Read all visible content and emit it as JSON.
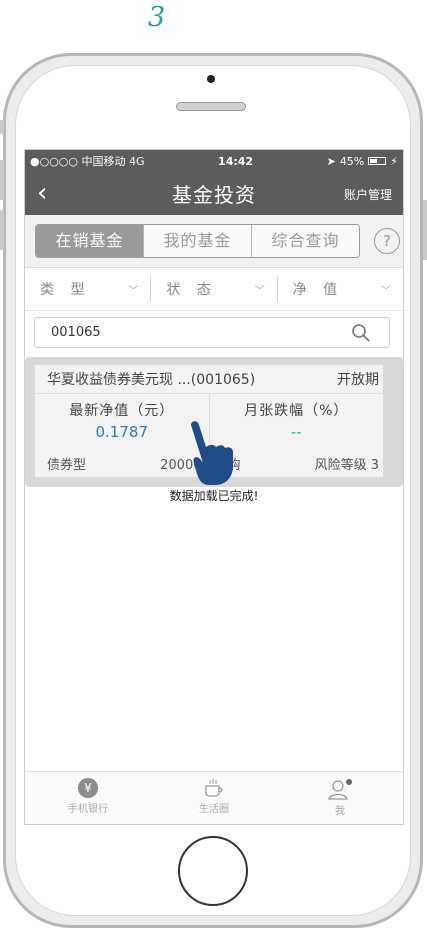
{
  "step_number": "3",
  "status_bar": {
    "carrier": "●○○○○ 中国移动 4G",
    "time": "14:42",
    "battery": "45%"
  },
  "nav": {
    "title": "基金投资",
    "right_label": "账户管理"
  },
  "tabs": [
    {
      "label": "在销基金",
      "active": true
    },
    {
      "label": "我的基金",
      "active": false
    },
    {
      "label": "综合查询",
      "active": false
    }
  ],
  "help_label": "?",
  "filters": [
    {
      "label": "类 型"
    },
    {
      "label": "状 态"
    },
    {
      "label": "净 值"
    }
  ],
  "search": {
    "value": "001065"
  },
  "fund": {
    "name": "华夏收益债券美元现 ...(001065)",
    "status": "开放期",
    "nav_label": "最新净值（元）",
    "nav_value": "0.1787",
    "change_label": "月张跌幅（%）",
    "change_value": "--",
    "type": "债券型",
    "min_amount": "20000元起购",
    "risk": "风险等级 3"
  },
  "toast": "数据加载已完成!",
  "bottom_tabs": [
    {
      "label": "手机银行",
      "icon": "yen-icon"
    },
    {
      "label": "生活圈",
      "icon": "coffee-icon"
    },
    {
      "label": "我",
      "icon": "user-icon"
    }
  ],
  "colors": {
    "nav_bg": "#5c5c5c",
    "active_tab": "#9a9a9a",
    "value_blue": "#2b7bb9",
    "step_teal": "#2a9d9a",
    "hand_blue": "#1f4d8a"
  }
}
